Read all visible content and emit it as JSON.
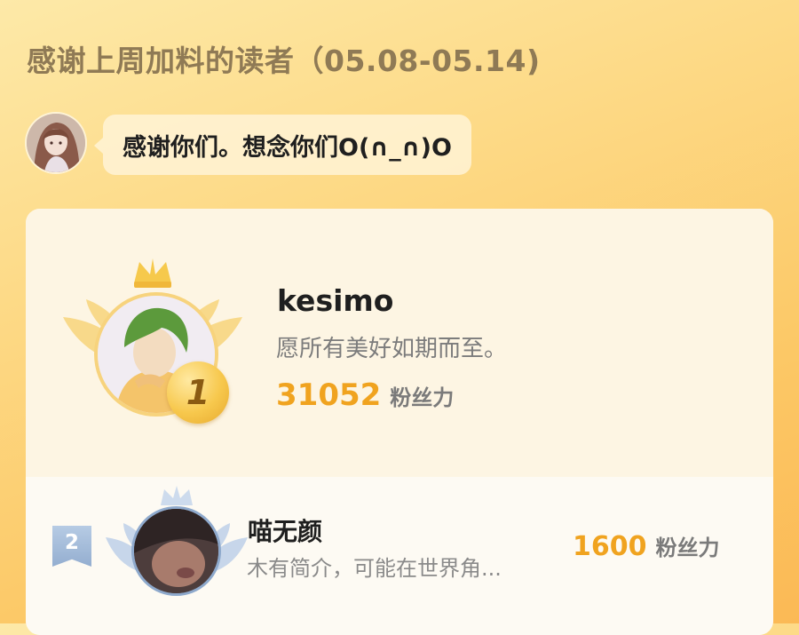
{
  "header": {
    "title": "感谢上周加料的读者（05.08-05.14)"
  },
  "author_note": {
    "avatar_icon": "author-avatar",
    "message": "感谢你们。想念你们O(∩_∩)O"
  },
  "leaderboard": {
    "top": {
      "rank": "1",
      "name": "kesimo",
      "bio": "愿所有美好如期而至。",
      "score": "31052",
      "score_unit": "粉丝力"
    },
    "second": {
      "rank": "2",
      "name": "喵无颜",
      "bio": "木有简介，可能在世界角...",
      "score": "1600",
      "score_unit": "粉丝力"
    }
  },
  "colors": {
    "accent": "#f0a31f",
    "gold": "#f7c84d",
    "silver": "#94aed0"
  }
}
